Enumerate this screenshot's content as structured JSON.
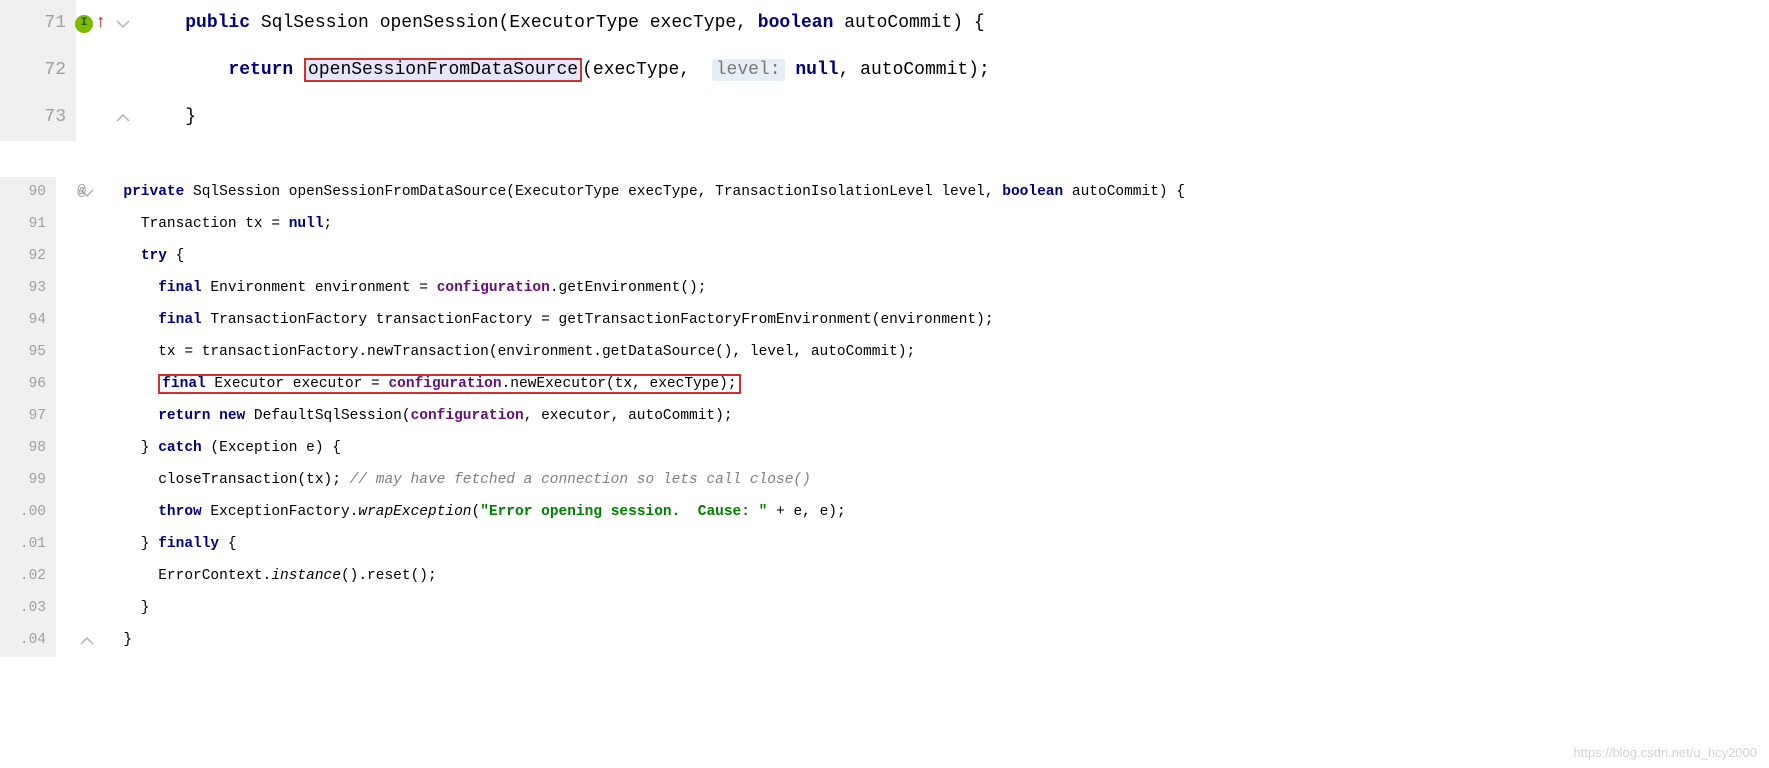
{
  "block1": {
    "lines": [
      {
        "num": "71",
        "marker": "override-up",
        "fold": "open-top",
        "tokens": [
          {
            "t": "    "
          },
          {
            "t": "public",
            "c": "kw"
          },
          {
            "t": " "
          },
          {
            "t": "SqlSession",
            "c": "type"
          },
          {
            "t": " "
          },
          {
            "t": "openSession"
          },
          {
            "t": "("
          },
          {
            "t": "ExecutorType",
            "c": "type"
          },
          {
            "t": " execType, "
          },
          {
            "t": "boolean",
            "c": "kw"
          },
          {
            "t": " autoCommit) {"
          }
        ]
      },
      {
        "num": "72",
        "marker": "",
        "fold": "",
        "tokens": [
          {
            "t": "        "
          },
          {
            "t": "return",
            "c": "kw"
          },
          {
            "t": " "
          },
          {
            "t": "openSessionFromDataSource",
            "c": "highlight1"
          },
          {
            "t": "(execType,  "
          },
          {
            "t": "level:",
            "c": "hint-bg"
          },
          {
            "t": " "
          },
          {
            "t": "null",
            "c": "kw"
          },
          {
            "t": ", autoCommit);"
          }
        ]
      },
      {
        "num": "73",
        "marker": "",
        "fold": "close-bottom",
        "tokens": [
          {
            "t": "    }"
          }
        ]
      }
    ]
  },
  "block2": {
    "lines": [
      {
        "num": "90",
        "marker": "at",
        "fold": "open-top",
        "tokens": [
          {
            "t": "  "
          },
          {
            "t": "private",
            "c": "kw"
          },
          {
            "t": " "
          },
          {
            "t": "SqlSession",
            "c": "type"
          },
          {
            "t": " openSessionFromDataSource(ExecutorType execType, TransactionIsolationLevel level, "
          },
          {
            "t": "boolean",
            "c": "kw"
          },
          {
            "t": " autoCommit) {"
          }
        ]
      },
      {
        "num": "91",
        "marker": "",
        "fold": "",
        "tokens": [
          {
            "t": "    Transaction tx = "
          },
          {
            "t": "null",
            "c": "kw"
          },
          {
            "t": ";"
          }
        ]
      },
      {
        "num": "92",
        "marker": "",
        "fold": "",
        "tokens": [
          {
            "t": "    "
          },
          {
            "t": "try",
            "c": "kw"
          },
          {
            "t": " {"
          }
        ]
      },
      {
        "num": "93",
        "marker": "",
        "fold": "",
        "tokens": [
          {
            "t": "      "
          },
          {
            "t": "final",
            "c": "kw"
          },
          {
            "t": " Environment environment = "
          },
          {
            "t": "configuration",
            "c": "field"
          },
          {
            "t": ".getEnvironment();"
          }
        ]
      },
      {
        "num": "94",
        "marker": "",
        "fold": "",
        "tokens": [
          {
            "t": "      "
          },
          {
            "t": "final",
            "c": "kw"
          },
          {
            "t": " TransactionFactory transactionFactory = getTransactionFactoryFromEnvironment(environment);"
          }
        ]
      },
      {
        "num": "95",
        "marker": "",
        "fold": "",
        "tokens": [
          {
            "t": "      tx = transactionFactory.newTransaction(environment.getDataSource(), level, autoCommit);"
          }
        ]
      },
      {
        "num": "96",
        "marker": "",
        "fold": "",
        "tokens": [
          {
            "t": "      "
          },
          {
            "w": "highlight2",
            "inner": [
              {
                "t": "final",
                "c": "kw"
              },
              {
                "t": " Executor executor = "
              },
              {
                "t": "configuration",
                "c": "field"
              },
              {
                "t": ".newExecutor(tx, execType);"
              }
            ]
          }
        ]
      },
      {
        "num": "97",
        "marker": "",
        "fold": "",
        "tokens": [
          {
            "t": "      "
          },
          {
            "t": "return new",
            "c": "kw"
          },
          {
            "t": " DefaultSqlSession("
          },
          {
            "t": "configuration",
            "c": "field"
          },
          {
            "t": ", executor, autoCommit);"
          }
        ]
      },
      {
        "num": "98",
        "marker": "",
        "fold": "",
        "tokens": [
          {
            "t": "    } "
          },
          {
            "t": "catch",
            "c": "kw"
          },
          {
            "t": " (Exception e) {"
          }
        ]
      },
      {
        "num": "99",
        "marker": "",
        "fold": "",
        "tokens": [
          {
            "t": "      closeTransaction(tx); "
          },
          {
            "t": "// may have fetched a connection so lets call close()",
            "c": "comment"
          }
        ]
      },
      {
        "num": ".00",
        "marker": "",
        "fold": "",
        "tokens": [
          {
            "t": "      "
          },
          {
            "t": "throw",
            "c": "kw"
          },
          {
            "t": " ExceptionFactory."
          },
          {
            "t": "wrapException",
            "c": "italic"
          },
          {
            "t": "("
          },
          {
            "t": "\"Error opening session.  Cause: \"",
            "c": "str"
          },
          {
            "t": " + e, e);"
          }
        ]
      },
      {
        "num": ".01",
        "marker": "",
        "fold": "",
        "tokens": [
          {
            "t": "    } "
          },
          {
            "t": "finally",
            "c": "kw"
          },
          {
            "t": " {"
          }
        ]
      },
      {
        "num": ".02",
        "marker": "",
        "fold": "",
        "tokens": [
          {
            "t": "      ErrorContext."
          },
          {
            "t": "instance",
            "c": "italic"
          },
          {
            "t": "().reset();"
          }
        ]
      },
      {
        "num": ".03",
        "marker": "",
        "fold": "",
        "tokens": [
          {
            "t": "    }"
          }
        ]
      },
      {
        "num": ".04",
        "marker": "",
        "fold": "close-bottom",
        "tokens": [
          {
            "t": "  }"
          }
        ]
      }
    ]
  },
  "watermark": "https://blog.csdn.net/u_hcy2000"
}
